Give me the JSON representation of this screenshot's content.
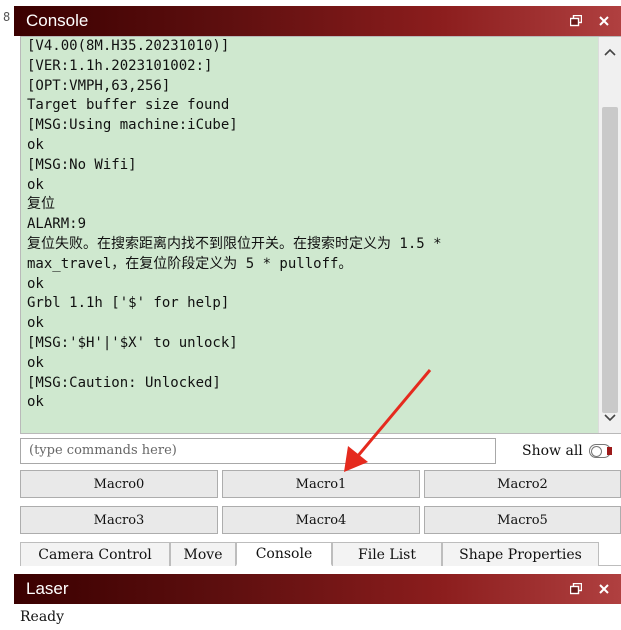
{
  "console_panel": {
    "title": "Console",
    "lines": [
      "[V4.00(8M.H35.20231010)]",
      "[VER:1.1h.2023101002:]",
      "[OPT:VMPH,63,256]",
      "Target buffer size found",
      "[MSG:Using machine:iCube]",
      "ok",
      "[MSG:No Wifi]",
      "ok",
      "复位",
      "ALARM:9",
      "复位失败。在搜索距离内找不到限位开关。在搜索时定义为 1.5 *",
      "max_travel，在复位阶段定义为 5 * pulloff。",
      "ok",
      "Grbl 1.1h ['$' for help]",
      "ok",
      "[MSG:'$H'|'$X' to unlock]",
      "ok",
      "[MSG:Caution: Unlocked]",
      "ok"
    ],
    "command_placeholder": "(type commands here)",
    "show_all_label": "Show all"
  },
  "macros": [
    "Macro0",
    "Macro1",
    "Macro2",
    "Macro3",
    "Macro4",
    "Macro5"
  ],
  "tabs": [
    {
      "label": "Camera Control",
      "active": false
    },
    {
      "label": "Move",
      "active": false
    },
    {
      "label": "Console",
      "active": true
    },
    {
      "label": "File List",
      "active": false
    },
    {
      "label": "Shape Properties",
      "active": false
    }
  ],
  "laser_panel": {
    "title": "Laser",
    "status": "Ready"
  },
  "icons": {
    "restore": "restore-icon",
    "close": "close-icon",
    "scroll_up": "chevron-up-icon",
    "scroll_down": "chevron-down-icon"
  },
  "colors": {
    "console_background": "#cfe8cf",
    "title_gradient_start": "#3a0000",
    "title_gradient_end": "#b04040",
    "annotation_arrow": "#e52a1e"
  }
}
